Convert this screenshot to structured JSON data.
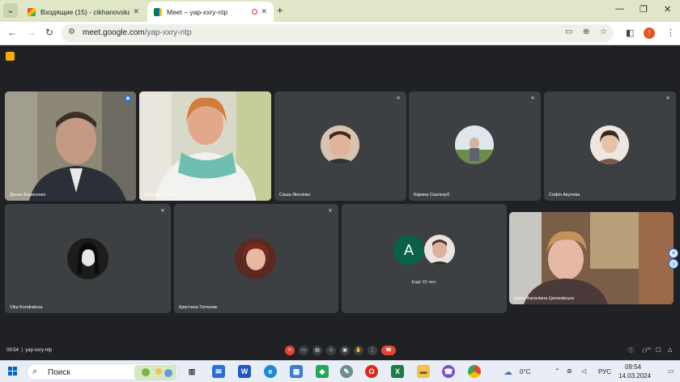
{
  "browser": {
    "tabs": [
      {
        "title": "Входящие (15) - cikhanovskaja@",
        "icon": "gmail-icon",
        "close": "✕"
      },
      {
        "title": "Meet – yap-xxry-ntp",
        "icon": "meet-icon",
        "close": "✕"
      }
    ],
    "new_tab": "+",
    "url_host": "meet.google.com",
    "url_path": "/yap-xxry-ntp",
    "profile_initial": "!",
    "accent": "#1a73e8"
  },
  "meet": {
    "participants": [
      {
        "name": "Денис Борисенко",
        "speaking": true
      },
      {
        "name": "Викторія Голош..."
      },
      {
        "name": "Саша Яконінко"
      },
      {
        "name": "Карина Скалозуб"
      },
      {
        "name": "Софія Акулова"
      },
      {
        "name": "Vika Kondratova"
      },
      {
        "name": "Кристина Тютюник"
      },
      {
        "name": "Ірина Василівна Циханівська"
      }
    ],
    "others": {
      "initial": "A",
      "label": "Ещё 15 чел."
    },
    "time": "09:54",
    "meeting_code": "yap-xxry-ntp",
    "participant_count": "29",
    "end_call_color": "#ea4335"
  },
  "taskbar": {
    "search_label": "Поиск",
    "weather": "0°C",
    "language": "РУС",
    "clock_time": "09:54",
    "clock_date": "14.03.2024",
    "apps": [
      "files",
      "mail",
      "word",
      "edge",
      "store",
      "steam",
      "pen",
      "excel",
      "explorer",
      "viber",
      "chrome"
    ]
  }
}
